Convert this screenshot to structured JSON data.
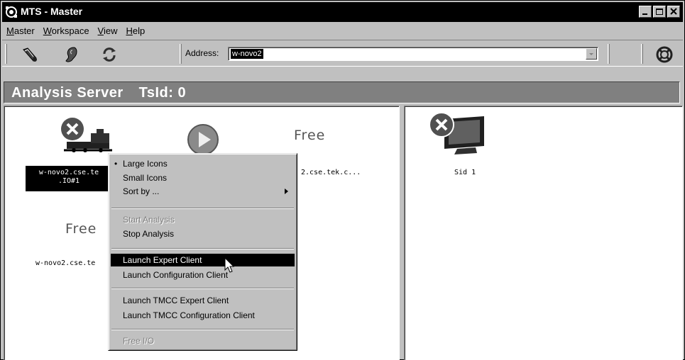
{
  "window": {
    "title": "MTS - Master"
  },
  "menubar": {
    "items": [
      {
        "label": "Master",
        "accel": "M"
      },
      {
        "label": "Workspace",
        "accel": "W"
      },
      {
        "label": "View",
        "accel": "V"
      },
      {
        "label": "Help",
        "accel": "H"
      }
    ]
  },
  "toolbar": {
    "address_label": "Address:",
    "address_value": "w-novo2",
    "icons": [
      "connect-icon",
      "ear-icon",
      "refresh-icon",
      "help-ring-icon"
    ]
  },
  "banner": {
    "server": "Analysis Server",
    "tsid": "TsId: 0"
  },
  "left_pane": {
    "items": [
      {
        "label_line1": "w-novo2.cse.te",
        "label_line2": ".IO#1",
        "selected": true,
        "icon": "train-stopped-icon"
      },
      {
        "label_line1": "2.cse.tek.c...",
        "icon": "play-icon"
      },
      {
        "label_line1": "Free"
      },
      {
        "label_line1": "Free"
      },
      {
        "label_line1": "w-novo2.cse.te"
      }
    ]
  },
  "right_pane": {
    "items": [
      {
        "label": "Sid 1",
        "icon": "monitor-stopped-icon"
      }
    ]
  },
  "context_menu": {
    "items": [
      {
        "label": "Large Icons",
        "checked": true
      },
      {
        "label": "Small Icons"
      },
      {
        "label": "Sort by ...",
        "submenu": true
      },
      {
        "label": "Start Analysis",
        "disabled": true
      },
      {
        "label": "Stop Analysis"
      },
      {
        "label": "Launch Expert Client",
        "highlighted": true
      },
      {
        "label": "Launch Configuration Client"
      },
      {
        "label": "Launch TMCC Expert Client"
      },
      {
        "label": "Launch TMCC Configuration Client"
      },
      {
        "label": "Free I/O",
        "disabled": true
      }
    ]
  }
}
